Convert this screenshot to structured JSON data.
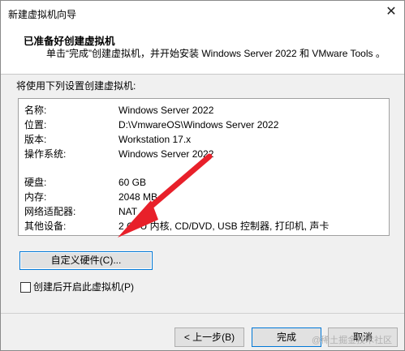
{
  "window": {
    "title": "新建虚拟机向导",
    "close_glyph": "✕"
  },
  "header": {
    "title": "已准备好创建虚拟机",
    "description": "单击“完成”创建虚拟机，并开始安装 Windows Server 2022 和 VMware Tools 。"
  },
  "body": {
    "label": "将使用下列设置创建虚拟机:"
  },
  "summary": [
    {
      "key": "名称:",
      "value": "Windows Server 2022"
    },
    {
      "key": "位置:",
      "value": "D:\\VmwareOS\\Windows Server 2022"
    },
    {
      "key": "版本:",
      "value": "Workstation 17.x"
    },
    {
      "key": "操作系统:",
      "value": "Windows Server 2022"
    },
    {
      "key": "硬盘:",
      "value": "60 GB"
    },
    {
      "key": "内存:",
      "value": "2048 MB"
    },
    {
      "key": "网络适配器:",
      "value": "NAT"
    },
    {
      "key": "其他设备:",
      "value": "2 CPU 内核, CD/DVD, USB 控制器, 打印机, 声卡"
    }
  ],
  "buttons": {
    "customize": "自定义硬件(C)...",
    "back": "< 上一步(B)",
    "finish": "完成",
    "cancel": "取消"
  },
  "checkbox": {
    "label": "创建后开启此虚拟机(P)",
    "checked": false
  },
  "watermark": "@稀土掘金技术社区",
  "annotation": {
    "arrow_color": "#e8202a"
  }
}
